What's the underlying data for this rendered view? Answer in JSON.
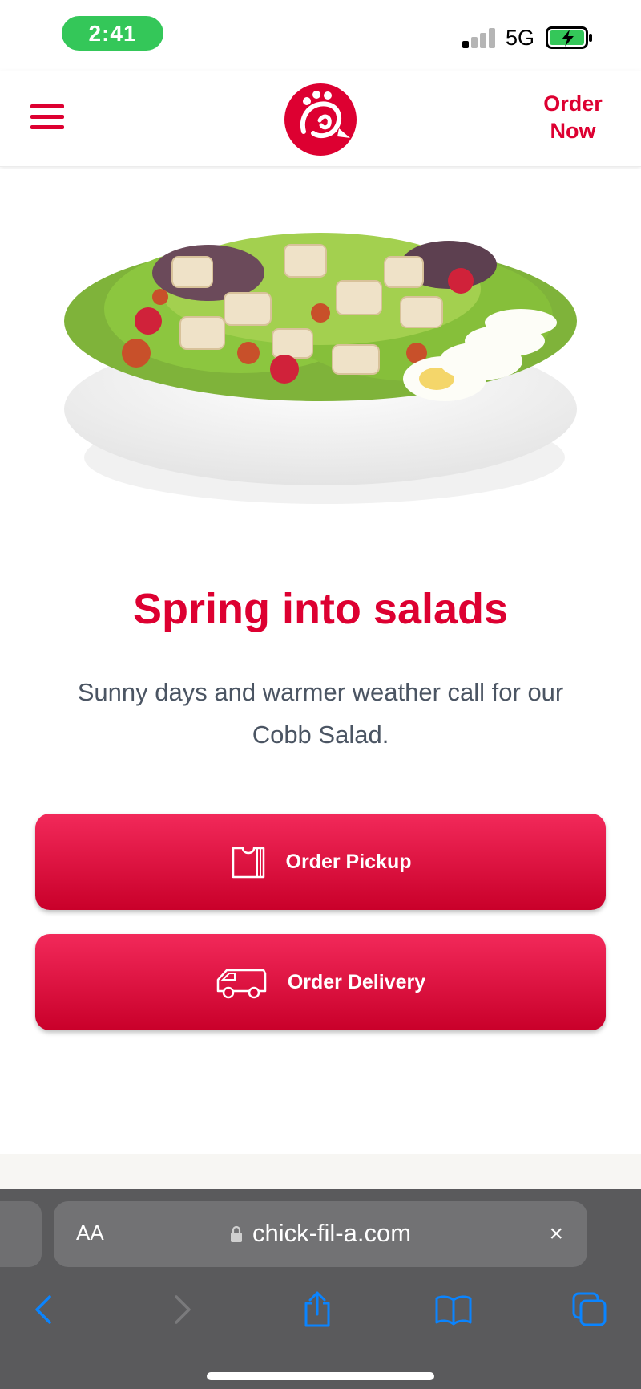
{
  "status_bar": {
    "time": "2:41",
    "network": "5G",
    "signal_icon": "cellular-signal-icon",
    "battery_icon": "battery-charging-icon"
  },
  "header": {
    "menu_icon": "hamburger-menu-icon",
    "logo": "chick-fil-a-logo",
    "order_now": "Order Now"
  },
  "hero": {
    "image": "cobb-salad-image"
  },
  "promo": {
    "headline": "Spring into salads",
    "body": "Sunny days and warmer weather call for our Cobb Salad."
  },
  "actions": {
    "pickup_label": "Order Pickup",
    "pickup_icon": "pickup-bag-icon",
    "delivery_label": "Order Delivery",
    "delivery_icon": "delivery-van-icon"
  },
  "browser": {
    "aa_label": "AA",
    "url": "chick-fil-a.com",
    "clear_label": "×",
    "nav_icons": [
      "back-icon",
      "forward-icon",
      "share-icon",
      "bookmarks-icon",
      "tabs-icon"
    ]
  },
  "colors": {
    "brand_red": "#dd0031",
    "status_green": "#34c759",
    "browser_bg": "#5a5a5c",
    "accent_blue": "#0a84ff"
  }
}
